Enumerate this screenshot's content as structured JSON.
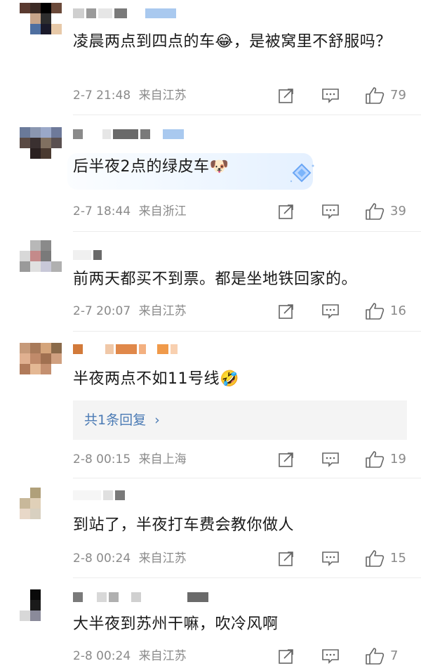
{
  "comments": [
    {
      "text": "凌晨两点到四点的车😂，是被窝里不舒服吗？",
      "date": "2-7 21:48",
      "location": "来自江苏",
      "likes": "79"
    },
    {
      "text": "后半夜2点的绿皮车🐶",
      "date": "2-7 18:44",
      "location": "来自浙江",
      "likes": "39"
    },
    {
      "text": "前两天都买不到票。都是坐地铁回家的。",
      "date": "2-7 20:07",
      "location": "来自江苏",
      "likes": "16"
    },
    {
      "text": "半夜两点不如11号线🤣",
      "date": "2-8 00:15",
      "location": "来自上海",
      "likes": "19",
      "reply_label": "共1条回复"
    },
    {
      "text": "到站了，半夜打车费会教你做人",
      "date": "2-8 00:24",
      "location": "来自江苏",
      "likes": "15"
    },
    {
      "text": "大半夜到苏州干嘛，吹冷风啊",
      "date": "2-8 00:24",
      "location": "来自江苏",
      "likes": "7"
    }
  ],
  "icons": {
    "share": "share-icon",
    "comment": "comment-icon",
    "like": "thumbs-up-icon",
    "chevron": "chevron-right-icon"
  },
  "colors": {
    "reply_link": "#4a7ab4",
    "meta_text": "#8a8a8a"
  }
}
